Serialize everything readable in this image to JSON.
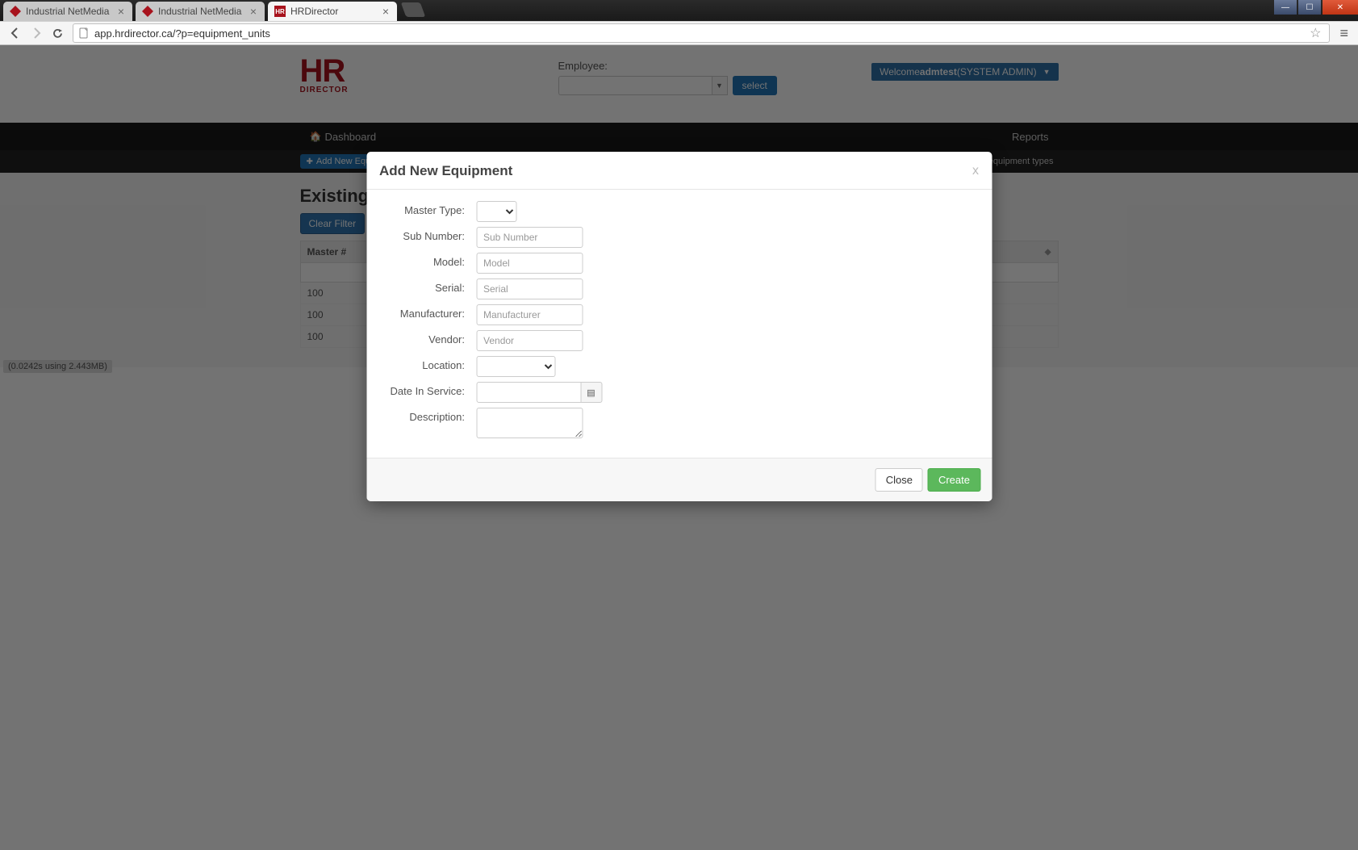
{
  "browser": {
    "tabs": [
      {
        "title": "Industrial NetMedia"
      },
      {
        "title": "Industrial NetMedia"
      },
      {
        "title": "HRDirector"
      }
    ],
    "url": "app.hrdirector.ca/?p=equipment_units"
  },
  "header": {
    "logo_top": "HR",
    "logo_sub": "DIRECTOR",
    "employee_label": "Employee:",
    "select_button": "select",
    "welcome_prefix": "Welcome ",
    "welcome_user": "admtest",
    "welcome_role": " (SYSTEM ADMIN)"
  },
  "nav": {
    "dashboard": "Dashboard",
    "reports": "Reports"
  },
  "subnav": {
    "add_button": "Add New Equipment",
    "link_types": "equipment types"
  },
  "page": {
    "title": "Existing",
    "clear_filter": "Clear Filter",
    "table": {
      "headers": {
        "master": "Master #",
        "last": ""
      },
      "rows": [
        "100",
        "100",
        "100"
      ]
    },
    "perf": "(0.0242s using 2.443MB)"
  },
  "modal": {
    "title": "Add New Equipment",
    "close_x": "x",
    "fields": {
      "master_type": "Master Type:",
      "sub_number": "Sub Number:",
      "sub_number_ph": "Sub Number",
      "model": "Model:",
      "model_ph": "Model",
      "serial": "Serial:",
      "serial_ph": "Serial",
      "manufacturer": "Manufacturer:",
      "manufacturer_ph": "Manufacturer",
      "vendor": "Vendor:",
      "vendor_ph": "Vendor",
      "location": "Location:",
      "date_in_service": "Date In Service:",
      "description": "Description:"
    },
    "buttons": {
      "close": "Close",
      "create": "Create"
    }
  }
}
